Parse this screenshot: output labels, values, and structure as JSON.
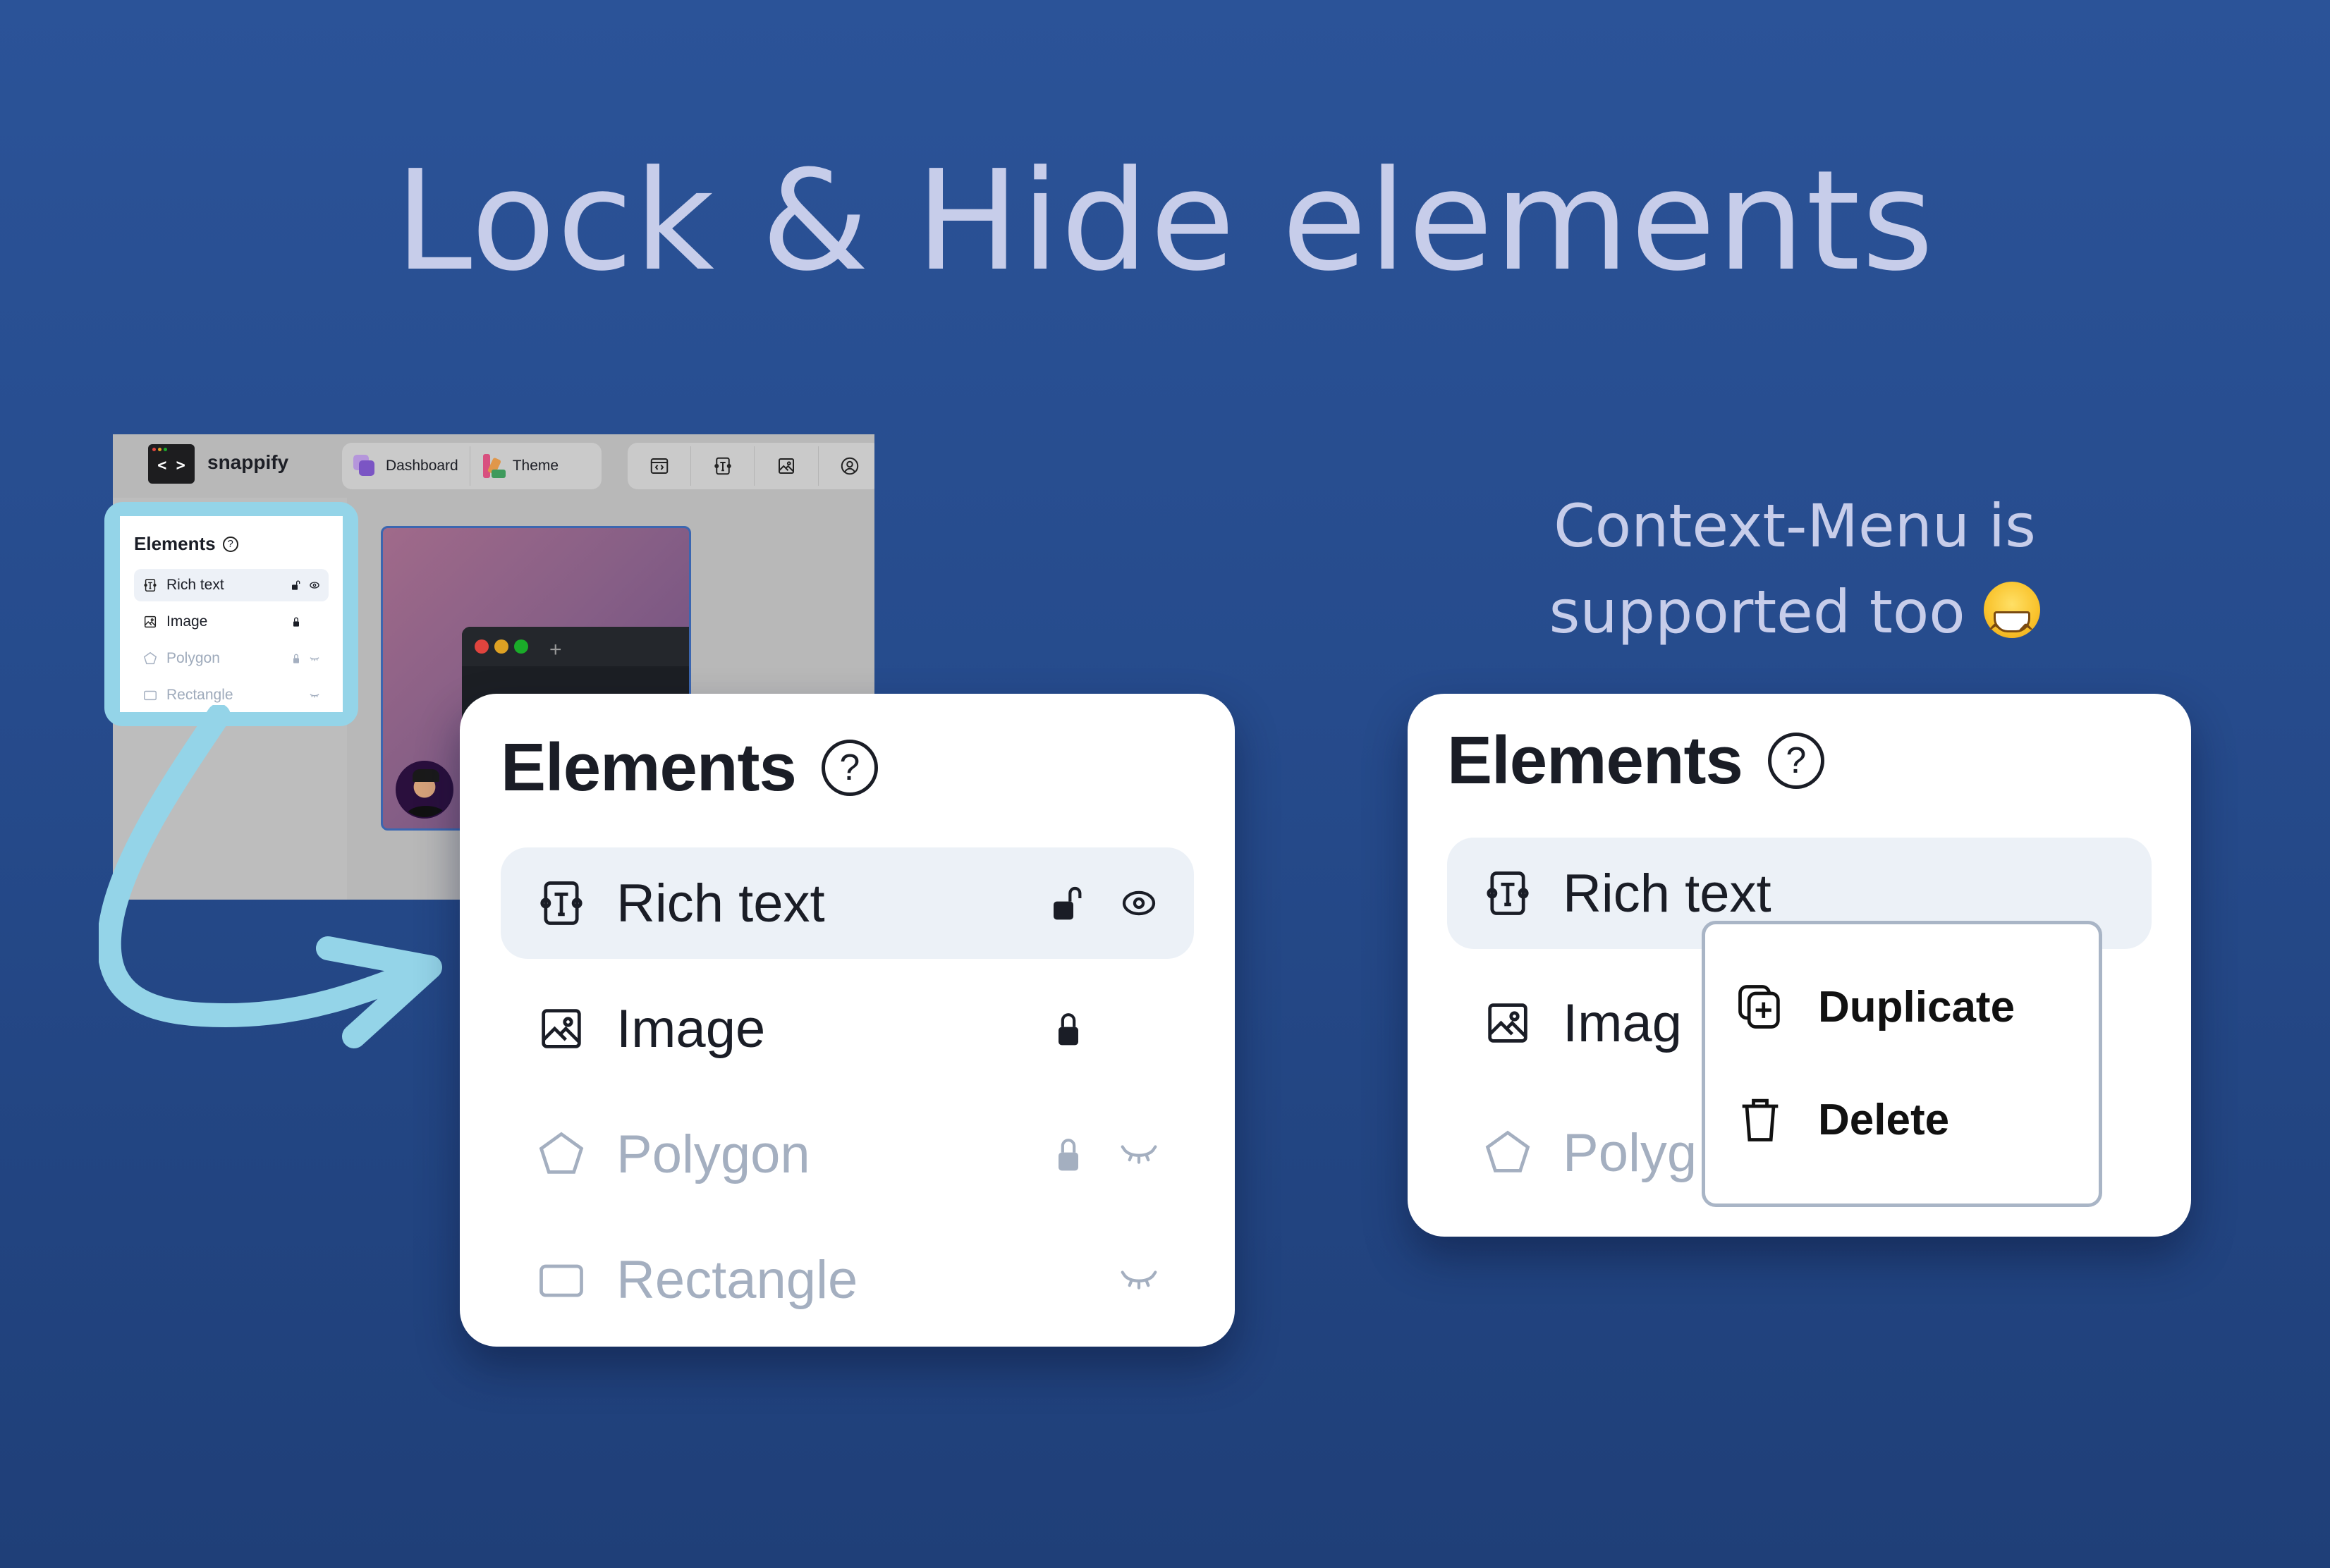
{
  "title": "Lock & Hide elements",
  "subtitle": {
    "line1": "Context-Menu is",
    "line2": "supported too",
    "emoji": "grinning-face-with-smiling-eyes"
  },
  "app": {
    "brand": "snappify",
    "logo_icon": "code-brackets-icon",
    "nav": [
      {
        "label": "Dashboard",
        "icon": "dashboard-icon"
      },
      {
        "label": "Theme",
        "icon": "theme-swatch-icon"
      }
    ],
    "toolbar_icons": [
      "code-window-icon",
      "rich-text-icon",
      "image-icon",
      "user-circle-icon"
    ],
    "terminal_plus": "+",
    "window_dot_colors": [
      "#e0443e",
      "#dea123",
      "#1aab29"
    ]
  },
  "panel": {
    "heading": "Elements",
    "help_icon": "question-circle-icon",
    "items": [
      {
        "label": "Rich text",
        "icon": "rich-text-icon",
        "lock": "unlocked",
        "visibility": "visible",
        "selected": true,
        "dimmed": false
      },
      {
        "label": "Image",
        "icon": "image-icon",
        "lock": "locked",
        "visibility": "",
        "selected": false,
        "dimmed": false
      },
      {
        "label": "Polygon",
        "icon": "polygon-icon",
        "lock": "locked",
        "visibility": "hidden",
        "selected": false,
        "dimmed": true
      },
      {
        "label": "Rectangle",
        "icon": "rectangle-icon",
        "lock": "",
        "visibility": "hidden",
        "selected": false,
        "dimmed": true
      }
    ]
  },
  "context_panel": {
    "heading": "Elements",
    "items": [
      {
        "label": "Rich text",
        "icon": "rich-text-icon"
      },
      {
        "label": "Imag",
        "icon": "image-icon"
      },
      {
        "label": "Polyg",
        "icon": "polygon-icon"
      }
    ],
    "menu": [
      {
        "label": "Duplicate",
        "icon": "duplicate-icon"
      },
      {
        "label": "Delete",
        "icon": "trash-icon"
      }
    ]
  },
  "colors": {
    "background_top": "#2b5398",
    "background_bottom": "#1f3f78",
    "title_text": "#c7cdea",
    "highlight": "#94d4e8",
    "selected_row": "#ecf1f7",
    "dimmed_text": "#a4afc0",
    "menu_border": "#a9b5c6"
  }
}
